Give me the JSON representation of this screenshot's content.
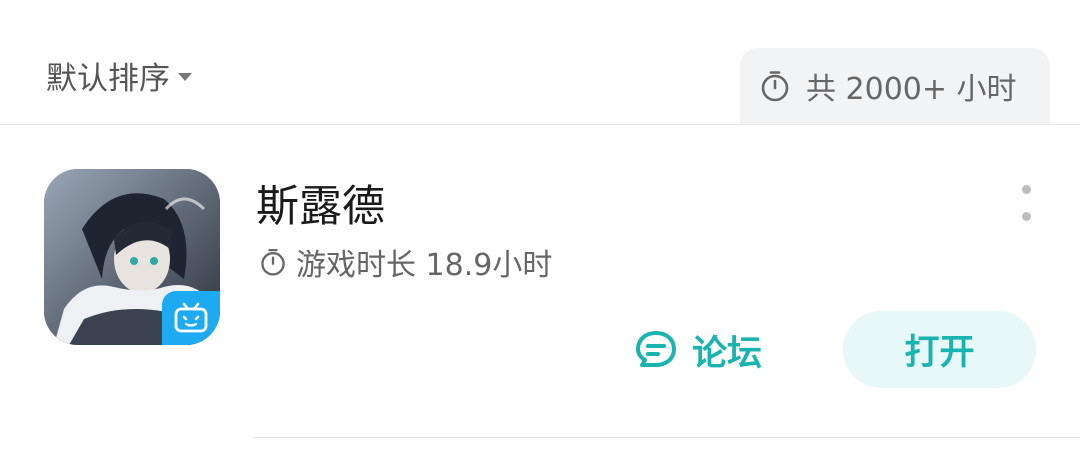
{
  "sort": {
    "label": "默认排序"
  },
  "total": {
    "label": "共 2000+ 小时"
  },
  "app": {
    "name": "斯露德",
    "playtime": "游戏时长 18.9小时",
    "forum_label": "论坛",
    "open_label": "打开"
  },
  "colors": {
    "accent": "#19b3b0",
    "open_bg": "#e8f7f7",
    "chip_bg": "#f2f3f5",
    "badge": "#1eaaf1"
  }
}
